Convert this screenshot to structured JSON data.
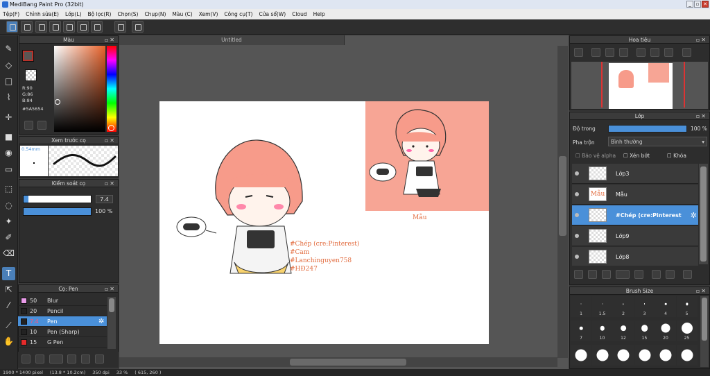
{
  "window": {
    "title": "MediBang Paint Pro (32bit)"
  },
  "menu": [
    "Tệp(F)",
    "Chỉnh sửa(E)",
    "Lớp(L)",
    "Bộ lọc(R)",
    "Chọn(S)",
    "Chụp(N)",
    "Màu (C)",
    "Xem(V)",
    "Công cụ(T)",
    "Cửa sổ(W)",
    "Cloud",
    "Help"
  ],
  "document": {
    "tab_title": "Untitled"
  },
  "color_panel": {
    "title": "Màu",
    "r": "R:90",
    "g": "G:86",
    "b": "B:84",
    "hex": "#5A5654",
    "main_color": "#5a5654",
    "sub_color": "#ffffff"
  },
  "brush_preview": {
    "title": "Xem trước cọ",
    "size": "0.54mm"
  },
  "brush_control": {
    "title": "Kiểm soát cọ",
    "size_value": "7.4",
    "opacity_value": "100 %",
    "size_fraction": 0.07,
    "opacity_fraction": 1.0
  },
  "brush_list": {
    "title": "Cọ: Pen",
    "items": [
      {
        "size": "50",
        "name": "Blur",
        "color": "#e99be9"
      },
      {
        "size": "20",
        "name": "Pencil",
        "color": "#222222"
      },
      {
        "size": "7.4",
        "name": "Pen",
        "color": "#222222"
      },
      {
        "size": "10",
        "name": "Pen (Sharp)",
        "color": "#222222"
      },
      {
        "size": "15",
        "name": "G Pen",
        "color": "#e62b2b"
      }
    ]
  },
  "navigator": {
    "title": "Hoa tiêu"
  },
  "layer_panel": {
    "title": "Lớp",
    "opacity_label": "Độ trong",
    "opacity_value": "100 %",
    "blend_label": "Pha trộn",
    "blend_value": "Bình thường",
    "protect_alpha": "Bảo vệ alpha",
    "clipping": "Xén bớt",
    "lock": "Khóa",
    "layers": [
      {
        "name": "Lớp3",
        "thumb": ""
      },
      {
        "name": "Mẫu",
        "thumb": "Mẫu"
      },
      {
        "name": "#Chép (cre:Pinterest",
        "thumb": ""
      },
      {
        "name": "Lớp9",
        "thumb": ""
      },
      {
        "name": "Lớp8",
        "thumb": ""
      }
    ]
  },
  "brush_size_panel": {
    "title": "Brush Size",
    "sizes": [
      "1",
      "1.5",
      "2",
      "3",
      "4",
      "5",
      "7",
      "10",
      "12",
      "15",
      "20",
      "25"
    ]
  },
  "canvas_text": {
    "mau_label": "Mẫu",
    "lines": [
      "#Chép (cre:Pinterest)",
      "#Cam",
      "#Lanchinguyen758",
      "#HĐ247"
    ]
  },
  "status": {
    "size": "1900 * 1400 pixel",
    "cm": "(13.8 * 10.2cm)",
    "dpi": "350 dpi",
    "zoom": "33 %",
    "coords": "( 615, 260 )"
  }
}
